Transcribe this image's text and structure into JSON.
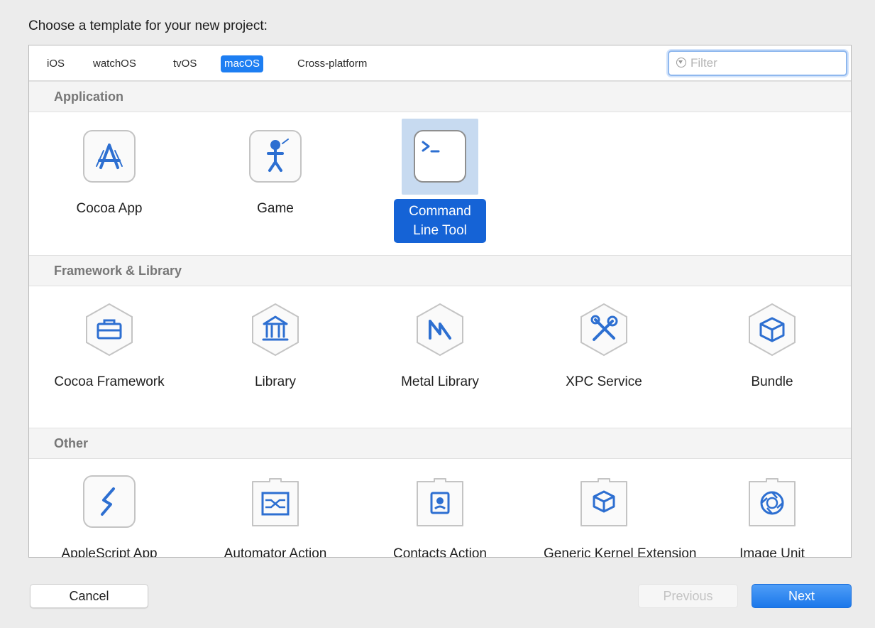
{
  "dialog": {
    "title": "Choose a template for your new project:"
  },
  "platforms": {
    "tabs": [
      {
        "label": "iOS"
      },
      {
        "label": "watchOS"
      },
      {
        "label": "tvOS"
      },
      {
        "label": "macOS"
      },
      {
        "label": "Cross-platform"
      }
    ],
    "selected": "macOS"
  },
  "filter": {
    "placeholder": "Filter",
    "value": "",
    "icon": "filter-icon"
  },
  "sections": [
    {
      "title": "Application",
      "templates": [
        {
          "label": "Cocoa App",
          "icon": "app-store-icon"
        },
        {
          "label": "Game",
          "icon": "game-icon"
        },
        {
          "label": "Command Line Tool",
          "icon": "terminal-icon",
          "selected": true
        }
      ]
    },
    {
      "title": "Framework & Library",
      "templates": [
        {
          "label": "Cocoa Framework",
          "icon": "toolbox-icon"
        },
        {
          "label": "Library",
          "icon": "bank-icon"
        },
        {
          "label": "Metal Library",
          "icon": "metal-icon"
        },
        {
          "label": "XPC Service",
          "icon": "tools-icon"
        },
        {
          "label": "Bundle",
          "icon": "cube-icon"
        }
      ]
    },
    {
      "title": "Other",
      "templates": [
        {
          "label": "AppleScript App",
          "icon": "applescript-icon"
        },
        {
          "label": "Automator Action",
          "icon": "automator-icon"
        },
        {
          "label": "Contacts Action",
          "icon": "contacts-icon"
        },
        {
          "label": "Generic Kernel Extension",
          "icon": "kernel-icon"
        },
        {
          "label": "Image Unit",
          "icon": "aperture-icon"
        }
      ]
    }
  ],
  "buttons": {
    "cancel": "Cancel",
    "previous": "Previous",
    "next": "Next"
  },
  "colors": {
    "accent": "#1d7ef2",
    "selection": "#1563d6",
    "icon_blue": "#2d6fd1",
    "icon_border": "#c4c4c4"
  }
}
